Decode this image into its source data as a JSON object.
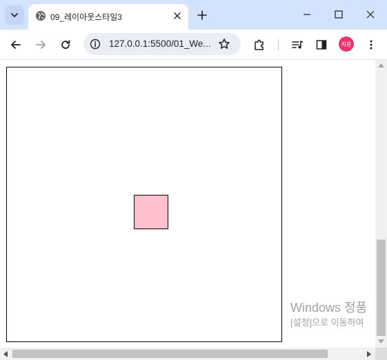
{
  "browser": {
    "tab": {
      "title": "09_레이아웃스타일3",
      "favicon": "globe-icon",
      "close_icon": "close-icon"
    },
    "new_tab_icon": "plus-icon",
    "tab_search_icon": "chevron-down-icon",
    "window_controls": [
      "minimize-icon",
      "maximize-icon",
      "close-icon"
    ],
    "toolbar": {
      "back_icon": "arrow-left-icon",
      "forward_icon": "arrow-right-icon",
      "reload_icon": "reload-icon",
      "url": "127.0.0.1:5500/01_We...",
      "site_info_icon": "info-icon",
      "bookmark_icon": "star-icon",
      "extensions_icon": "puzzle-icon",
      "media_icon": "media-queue-icon",
      "sidepanel_icon": "side-panel-icon",
      "profile_label": "지윤",
      "menu_icon": "more-vertical-icon"
    }
  },
  "page": {
    "outer_box_color": "#ffffff",
    "inner_box_color": "#ffc0cb",
    "border_color": "#000000"
  },
  "os_watermark": {
    "title": "Windows 정품",
    "subtitle": "[설정]으로 이동하여"
  },
  "colors": {
    "tabstrip": "#d3e3fd",
    "avatar": "#e8336d",
    "scrollbar_thumb": "#c1c1c1"
  }
}
